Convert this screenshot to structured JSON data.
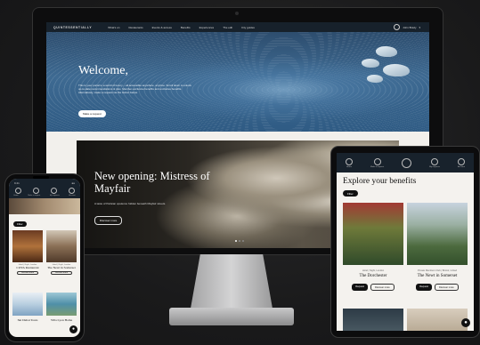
{
  "desktop": {
    "logo": "QUINTESSENTIALLY",
    "nav": [
      "What's on",
      "Restaurants",
      "Events & access",
      "Benefits",
      "Experiences",
      "The edit",
      "City guides"
    ],
    "user_name": "John Brady",
    "hero": {
      "title": "Welcome,",
      "text": "This is your portal to a world of luxury – all accessible anywhere, anytime. Scroll down to unlock up-to-date recommendations & plus. Member-exclusive benefits and exclusive benefits. Alternatively, make a request via the button below.",
      "button": "Make a request"
    },
    "feature": {
      "title": "New opening: Mistress of Mayfair",
      "subtitle": "A taste of Parisian opulence hidden beneath Mayfair streets.",
      "button": "Discover more"
    }
  },
  "tablet": {
    "nav": [
      "Home",
      "Make a request",
      "My requests",
      "Account"
    ],
    "title": "Explore your benefits",
    "filter": "Filter",
    "cards": [
      {
        "location": "Hotel | Night, London",
        "name": "The Dorchester",
        "b1": "Request",
        "b2": "Discover more"
      },
      {
        "location": "Private Members Club | Bristol, United",
        "name": "The Newt in Somerset",
        "b1": "Request",
        "b2": "Discover more"
      }
    ]
  },
  "phone": {
    "time": "9:41",
    "nav": [
      "Home",
      "Make a request",
      "My requests",
      "Account"
    ],
    "filter": "Filter",
    "cards": [
      {
        "location": "Hotel | Night, London",
        "name": "COYA Restaurant",
        "button": "Discover more"
      },
      {
        "location": "Hotel | Night, London",
        "name": "The Newt in Somerset",
        "button": "Discover more"
      },
      {
        "location": "",
        "name": "Ski Dubai Tours",
        "button": ""
      },
      {
        "location": "",
        "name": "Villa Lyon Home",
        "button": ""
      }
    ]
  }
}
